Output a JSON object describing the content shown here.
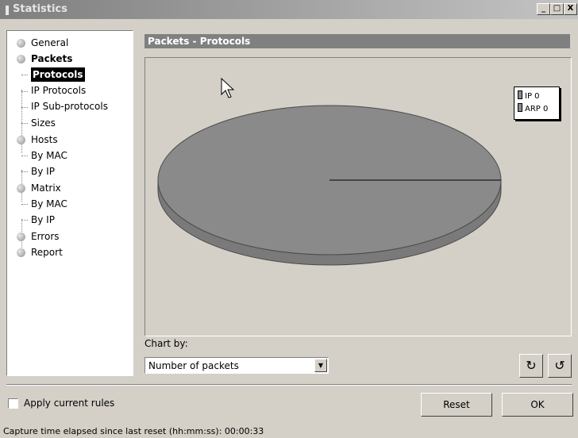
{
  "window": {
    "title": "Statistics",
    "controls": [
      "_",
      "□",
      "X"
    ]
  },
  "nav": {
    "items": [
      {
        "label": "General"
      },
      {
        "label": "Packets"
      },
      {
        "label": "Protocols"
      },
      {
        "label": "IP Protocols"
      },
      {
        "label": "IP Sub-protocols"
      },
      {
        "label": "Sizes"
      },
      {
        "label": "Hosts"
      },
      {
        "label": "By MAC"
      },
      {
        "label": "By IP"
      },
      {
        "label": "Matrix"
      },
      {
        "label": "By MAC"
      },
      {
        "label": "By IP"
      },
      {
        "label": "Errors"
      },
      {
        "label": "Report"
      }
    ],
    "selected": "Protocols"
  },
  "panel": {
    "title": "Packets - Protocols"
  },
  "chart_data": {
    "type": "pie",
    "series": [
      {
        "name": "IP",
        "value": 0
      },
      {
        "name": "ARP",
        "value": 0
      }
    ],
    "legend_position": "top-right",
    "legend_entries": [
      "IP 0",
      "ARP 0"
    ]
  },
  "chart_by": {
    "label": "Chart by:",
    "value": "Number of packets"
  },
  "apply_rules": {
    "label": "Apply current rules",
    "checked": false
  },
  "buttons": {
    "reset": "Reset",
    "ok": "OK"
  },
  "status": {
    "text": "Capture time elapsed since last reset (hh:mm:ss): 00:00:33"
  },
  "colors": {
    "title_bar": "#808080",
    "panel_header": "#808080",
    "pie": "#8a8a8a"
  }
}
